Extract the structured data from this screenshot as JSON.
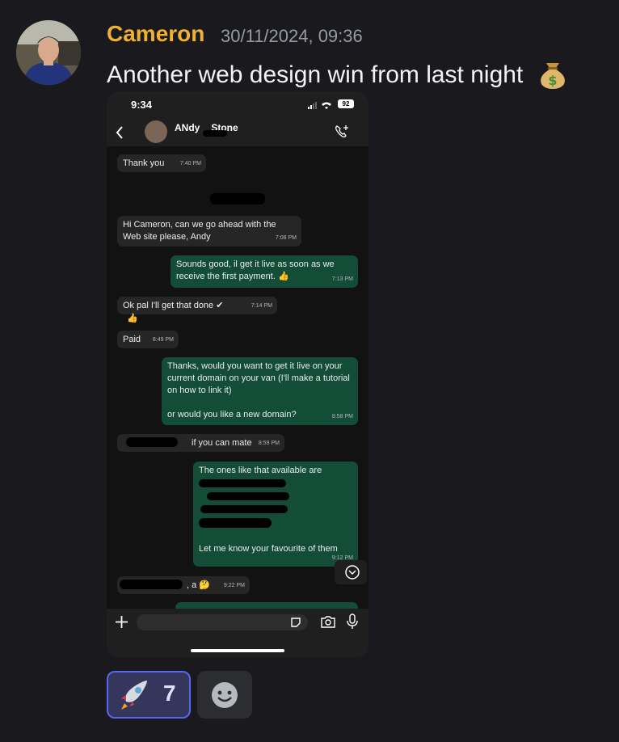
{
  "message": {
    "author": "Cameron",
    "timestamp": "30/11/2024, 09:36",
    "text": "Another web design win from last night",
    "emoji_icon": "money-bag-icon",
    "author_color": "#f0b132"
  },
  "screenshot": {
    "status_time": "9:34",
    "battery": "92",
    "contact_name": "ANdy",
    "contact_name_suffix": "Stone",
    "messages": [
      {
        "dir": "in",
        "text": "Thank you",
        "time": "7:40 PM"
      },
      {
        "dir": "in",
        "text": "Hi Cameron,  can we go ahead with the Web site please,  Andy",
        "time": "7:08 PM"
      },
      {
        "dir": "out",
        "text": "Sounds good, il get it live as soon as we receive the first payment. 👍",
        "time": "7:13 PM"
      },
      {
        "dir": "in",
        "text": "Ok pal I'll get that done ✔",
        "time": "7:14 PM",
        "reaction": "👍"
      },
      {
        "dir": "in",
        "text": "Paid",
        "time": "8:49 PM"
      },
      {
        "dir": "out",
        "text": "Thanks, would you want to get it live on your current domain on your van (I'll make a tutorial on how to link it)",
        "text2": "or would you like a new domain?",
        "time": "8:58 PM"
      },
      {
        "dir": "in",
        "text": "if you can mate",
        "time": "8:59 PM"
      },
      {
        "dir": "out",
        "text": "The ones like that available are",
        "text2": "Let me know your favourite of them",
        "time": "9:12 PM"
      },
      {
        "dir": "in",
        "text": ", a 🤔",
        "time": "9:22 PM"
      }
    ]
  },
  "reactions": {
    "count": "7",
    "emoji_icon": "rocket-icon",
    "add_icon": "add-reaction-icon",
    "accent": "#5865f2"
  }
}
